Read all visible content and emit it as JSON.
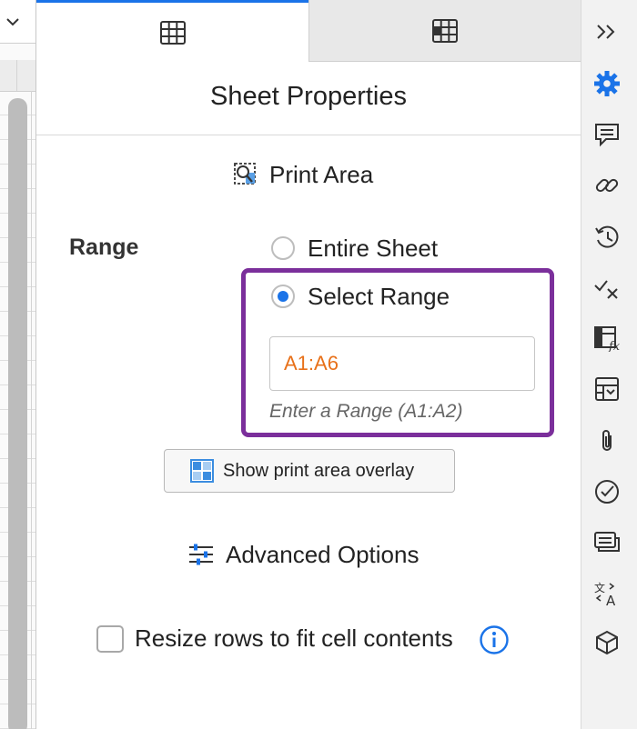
{
  "colors": {
    "accent": "#1a73e8",
    "highlight_border": "#7b2f9b",
    "range_value": "#e8711a"
  },
  "tabs": [
    {
      "name": "sheet",
      "icon": "table-grid-icon",
      "active": true
    },
    {
      "name": "cell",
      "icon": "cell-select-icon",
      "active": false
    }
  ],
  "panel": {
    "title": "Sheet Properties",
    "print_area": {
      "label": "Print Area",
      "icon": "print-area-icon"
    },
    "range": {
      "label": "Range",
      "options": [
        {
          "label": "Entire Sheet",
          "checked": false
        },
        {
          "label": "Select Range",
          "checked": true
        }
      ],
      "input_value": "A1:A6",
      "hint": "Enter a Range (A1:A2)"
    },
    "overlay_button": {
      "label": "Show print area overlay",
      "icon": "overlay-grid-icon"
    },
    "advanced_options": {
      "label": "Advanced Options",
      "icon": "sliders-icon"
    },
    "resize_rows": {
      "label": "Resize rows to fit cell contents",
      "checked": false,
      "icon": "info-icon"
    }
  },
  "right_rail": [
    "collapse-chevrons-icon",
    "gear-icon",
    "comment-icon",
    "link-icon",
    "history-icon",
    "check-x-icon",
    "function-icon",
    "table-dropdown-icon",
    "attachment-icon",
    "check-circle-icon",
    "cards-icon",
    "translate-icon",
    "cube-icon"
  ]
}
